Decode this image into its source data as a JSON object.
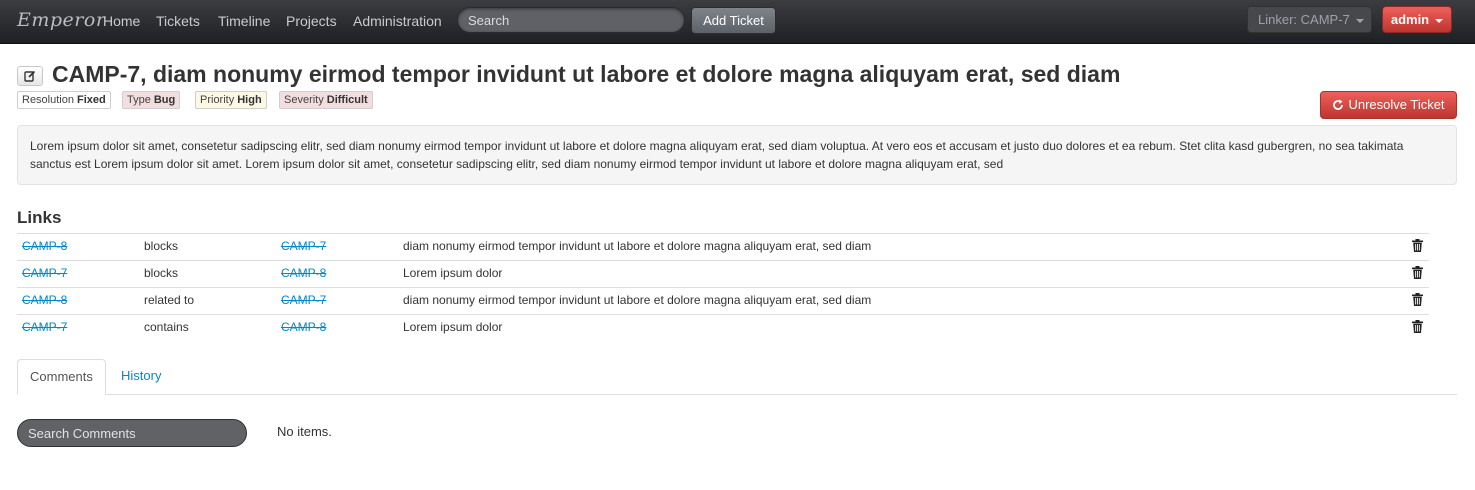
{
  "navbar": {
    "brand": "Emperor",
    "links": [
      "Home",
      "Tickets",
      "Timeline",
      "Projects",
      "Administration"
    ],
    "search_placeholder": "Search",
    "add_ticket": "Add Ticket",
    "linker": "Linker: CAMP-7",
    "user": "admin"
  },
  "ticket": {
    "title": "CAMP-7, diam nonumy eirmod tempor invidunt ut labore et dolore magna aliquyam erat, sed diam",
    "tags": [
      {
        "label": "Resolution",
        "value": "Fixed",
        "bg": "#ffffff"
      },
      {
        "label": "Type",
        "value": "Bug",
        "bg": "#f2dede"
      },
      {
        "label": "Priority",
        "value": "High",
        "bg": "#fcf8e3"
      },
      {
        "label": "Severity",
        "value": "Difficult",
        "bg": "#f2dede"
      }
    ],
    "unresolve_label": "Unresolve Ticket",
    "description": "Lorem ipsum dolor sit amet, consetetur sadipscing elitr, sed diam nonumy eirmod tempor invidunt ut labore et dolore magna aliquyam erat, sed diam voluptua. At vero eos et accusam et justo duo dolores et ea rebum. Stet clita kasd gubergren, no sea takimata sanctus est Lorem ipsum dolor sit amet. Lorem ipsum dolor sit amet, consetetur sadipscing elitr, sed diam nonumy eirmod tempor invidunt ut labore et dolore magna aliquyam erat, sed"
  },
  "links": {
    "title": "Links",
    "rows": [
      {
        "source": "CAMP-8",
        "relation": "blocks",
        "target": "CAMP-7",
        "summary": "diam nonumy eirmod tempor invidunt ut labore et dolore magna aliquyam erat, sed diam"
      },
      {
        "source": "CAMP-7",
        "relation": "blocks",
        "target": "CAMP-8",
        "summary": "Lorem ipsum dolor"
      },
      {
        "source": "CAMP-8",
        "relation": "related to",
        "target": "CAMP-7",
        "summary": "diam nonumy eirmod tempor invidunt ut labore et dolore magna aliquyam erat, sed diam"
      },
      {
        "source": "CAMP-7",
        "relation": "contains",
        "target": "CAMP-8",
        "summary": "Lorem ipsum dolor"
      }
    ]
  },
  "tabs": {
    "comments": "Comments",
    "history": "History"
  },
  "comments": {
    "search_placeholder": "Search Comments",
    "empty": "No items."
  },
  "colors": {
    "link": "#0088cc",
    "danger": "#da4f49"
  }
}
